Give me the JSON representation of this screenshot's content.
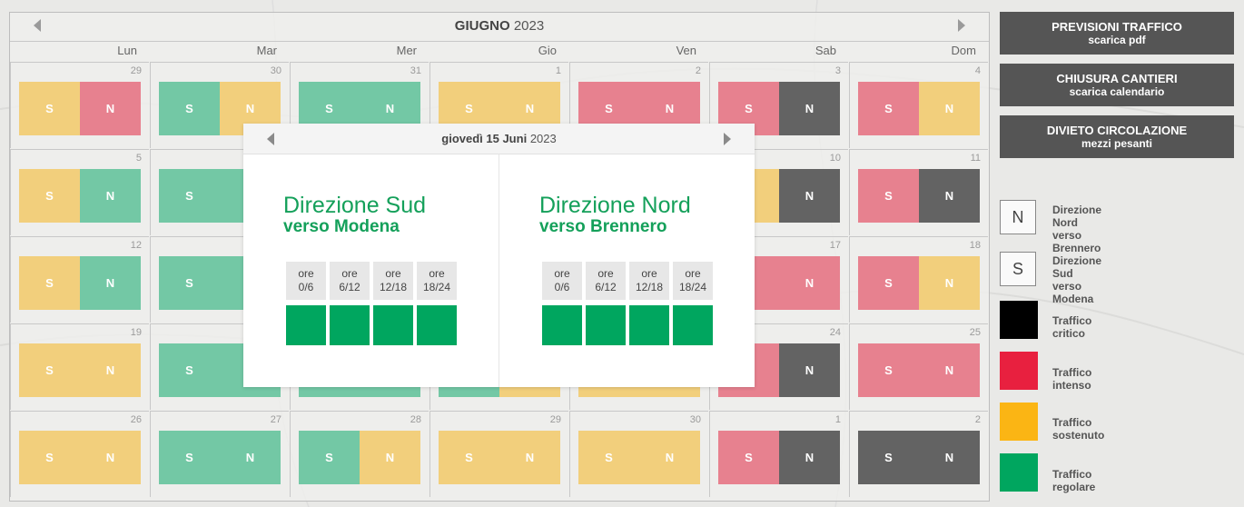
{
  "colors": {
    "yellow": "#f2cf7c",
    "red": "#e7818f",
    "green": "#73c8a5",
    "gray": "#636363",
    "legend_black": "#000000",
    "legend_red": "#e8203f",
    "legend_yellow": "#fbb514",
    "legend_green": "#00a65f",
    "popup_green": "#00a65f"
  },
  "calendar": {
    "month_bold": "GIUGNO",
    "year": "2023",
    "days_of_week": [
      "Lun",
      "Mar",
      "Mer",
      "Gio",
      "Ven",
      "Sab",
      "Dom"
    ],
    "weeks": [
      [
        {
          "num": "29",
          "s": "yellow",
          "n": "red"
        },
        {
          "num": "30",
          "s": "green",
          "n": "yellow"
        },
        {
          "num": "31",
          "s": "green",
          "n": "green"
        },
        {
          "num": "1",
          "s": "yellow",
          "n": "yellow"
        },
        {
          "num": "2",
          "s": "red",
          "n": "red"
        },
        {
          "num": "3",
          "s": "red",
          "n": "gray"
        },
        {
          "num": "4",
          "s": "red",
          "n": "yellow"
        }
      ],
      [
        {
          "num": "5",
          "s": "yellow",
          "n": "green"
        },
        {
          "num": "",
          "s": "green",
          "n": "green"
        },
        {
          "num": "",
          "s": "green",
          "n": "green"
        },
        {
          "num": "",
          "s": "green",
          "n": "green"
        },
        {
          "num": "",
          "s": "yellow",
          "n": "yellow"
        },
        {
          "num": "10",
          "s": "yellow",
          "n": "gray"
        },
        {
          "num": "11",
          "s": "red",
          "n": "gray"
        }
      ],
      [
        {
          "num": "12",
          "s": "yellow",
          "n": "green"
        },
        {
          "num": "",
          "s": "green",
          "n": "green"
        },
        {
          "num": "",
          "s": "green",
          "n": "green"
        },
        {
          "num": "",
          "s": "green",
          "n": "green"
        },
        {
          "num": "",
          "s": "yellow",
          "n": "yellow"
        },
        {
          "num": "17",
          "s": "red",
          "n": "red"
        },
        {
          "num": "18",
          "s": "red",
          "n": "yellow"
        }
      ],
      [
        {
          "num": "19",
          "s": "yellow",
          "n": "yellow"
        },
        {
          "num": "",
          "s": "green",
          "n": "green"
        },
        {
          "num": "",
          "s": "green",
          "n": "green"
        },
        {
          "num": "",
          "s": "green",
          "n": "yellow"
        },
        {
          "num": "",
          "s": "yellow",
          "n": "yellow"
        },
        {
          "num": "24",
          "s": "red",
          "n": "gray"
        },
        {
          "num": "25",
          "s": "red",
          "n": "red"
        }
      ],
      [
        {
          "num": "26",
          "s": "yellow",
          "n": "yellow"
        },
        {
          "num": "27",
          "s": "green",
          "n": "green"
        },
        {
          "num": "28",
          "s": "green",
          "n": "yellow"
        },
        {
          "num": "29",
          "s": "yellow",
          "n": "yellow"
        },
        {
          "num": "30",
          "s": "yellow",
          "n": "yellow"
        },
        {
          "num": "1",
          "s": "red",
          "n": "gray"
        },
        {
          "num": "2",
          "s": "gray",
          "n": "gray"
        }
      ]
    ],
    "s_letter": "S",
    "n_letter": "N"
  },
  "popup": {
    "date_bold": "giovedì 15 Juni",
    "date_year": "2023",
    "south": {
      "line1": "Direzione Sud",
      "line2": "verso Modena"
    },
    "north": {
      "line1": "Direzione Nord",
      "line2": "verso Brennero"
    },
    "slot_prefix": "ore",
    "slots": [
      "0/6",
      "6/12",
      "12/18",
      "18/24"
    ]
  },
  "buttons": [
    {
      "line1": "PREVISIONI TRAFFICO",
      "line2": "scarica pdf"
    },
    {
      "line1": "CHIUSURA CANTIERI",
      "line2": "scarica calendario"
    },
    {
      "line1": "DIVIETO CIRCOLAZIONE",
      "line2": "mezzi pesanti"
    }
  ],
  "legend": {
    "north": {
      "letter": "N",
      "line1": "Direzione Nord",
      "line2": "verso Brennero"
    },
    "south": {
      "letter": "S",
      "line1": "Direzione Sud",
      "line2": "verso Modena"
    },
    "critical": "Traffico critico",
    "intense": "Traffico intenso",
    "sustained": "Traffico sostenuto",
    "regular": "Traffico regolare"
  }
}
